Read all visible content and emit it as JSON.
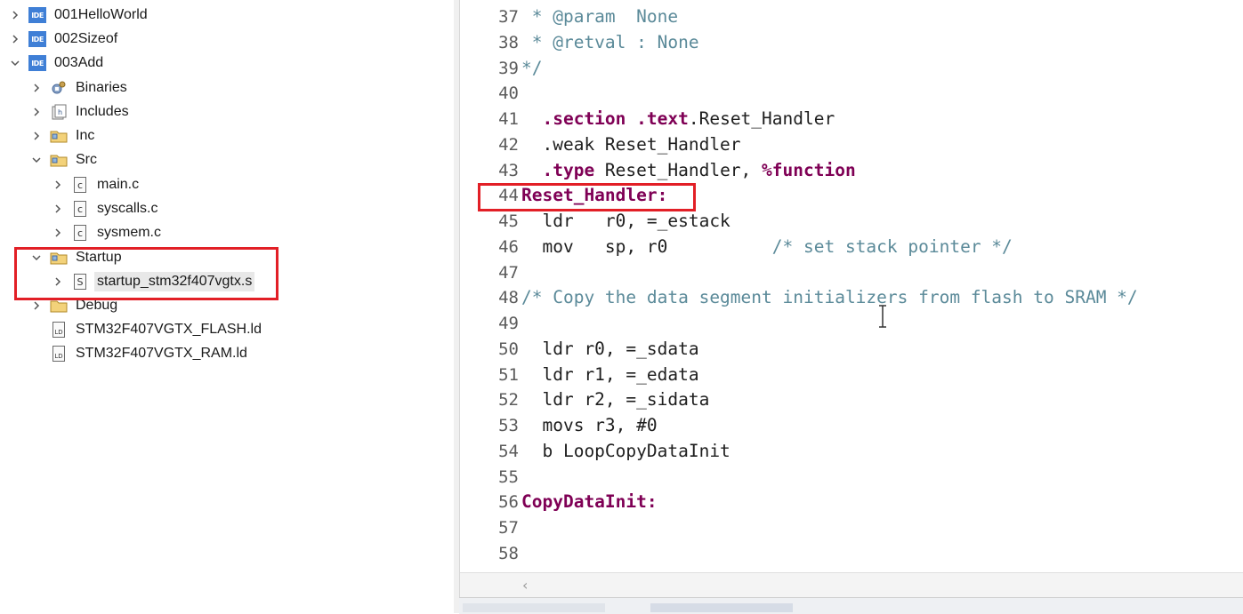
{
  "tree": {
    "projects": [
      {
        "label": "001HelloWorld",
        "expanded": false
      },
      {
        "label": "002Sizeof",
        "expanded": false
      },
      {
        "label": "003Add",
        "expanded": true
      }
    ],
    "children": {
      "binaries": "Binaries",
      "includes": "Includes",
      "inc": "Inc",
      "src": "Src",
      "src_files": [
        "main.c",
        "syscalls.c",
        "sysmem.c"
      ],
      "startup": "Startup",
      "startup_file": "startup_stm32f407vgtx.s",
      "debug": "Debug",
      "ld_files": [
        "STM32F407VGTX_FLASH.ld",
        "STM32F407VGTX_RAM.ld"
      ]
    },
    "icons": {
      "ide": "IDE",
      "c_file": "c",
      "s_file": "S",
      "ld_file": "LD"
    }
  },
  "editor": {
    "lines": [
      {
        "n": "37",
        "parts": [
          {
            "t": " * @param  None",
            "c": "cm"
          }
        ]
      },
      {
        "n": "38",
        "parts": [
          {
            "t": " * @retval : None",
            "c": "cm"
          }
        ]
      },
      {
        "n": "39",
        "parts": [
          {
            "t": "*/",
            "c": "cm"
          }
        ]
      },
      {
        "n": "40",
        "parts": []
      },
      {
        "n": "41",
        "parts": [
          {
            "t": "  ",
            "c": ""
          },
          {
            "t": ".section .text",
            "c": "kw"
          },
          {
            "t": ".Reset_Handler",
            "c": ""
          }
        ]
      },
      {
        "n": "42",
        "parts": [
          {
            "t": "  .weak Reset_Handler",
            "c": ""
          }
        ]
      },
      {
        "n": "43",
        "parts": [
          {
            "t": "  ",
            "c": ""
          },
          {
            "t": ".type",
            "c": "kw"
          },
          {
            "t": " Reset_Handler, ",
            "c": ""
          },
          {
            "t": "%function",
            "c": "kw"
          }
        ]
      },
      {
        "n": "44",
        "parts": [
          {
            "t": "Reset_Handler:",
            "c": "lab"
          }
        ]
      },
      {
        "n": "45",
        "parts": [
          {
            "t": "  ldr   r0, =_estack",
            "c": ""
          }
        ]
      },
      {
        "n": "46",
        "parts": [
          {
            "t": "  mov   sp, r0          ",
            "c": ""
          },
          {
            "t": "/* set stack pointer */",
            "c": "cm"
          }
        ]
      },
      {
        "n": "47",
        "parts": []
      },
      {
        "n": "48",
        "parts": [
          {
            "t": "/* Copy the data segment initializers from flash to SRAM */",
            "c": "cm"
          }
        ]
      },
      {
        "n": "49",
        "parts": []
      },
      {
        "n": "50",
        "parts": [
          {
            "t": "  ldr r0, =_sdata",
            "c": ""
          }
        ]
      },
      {
        "n": "51",
        "parts": [
          {
            "t": "  ldr r1, =_edata",
            "c": ""
          }
        ]
      },
      {
        "n": "52",
        "parts": [
          {
            "t": "  ldr r2, =_sidata",
            "c": ""
          }
        ]
      },
      {
        "n": "53",
        "parts": [
          {
            "t": "  movs r3, #0",
            "c": ""
          }
        ]
      },
      {
        "n": "54",
        "parts": [
          {
            "t": "  b LoopCopyDataInit",
            "c": ""
          }
        ]
      },
      {
        "n": "55",
        "parts": []
      },
      {
        "n": "56",
        "parts": [
          {
            "t": "CopyDataInit:",
            "c": "lab"
          }
        ]
      },
      {
        "n": "57",
        "parts": []
      },
      {
        "n": "58",
        "parts": []
      }
    ],
    "scroll_left_glyph": "‹"
  },
  "colors": {
    "highlight_box": "#e21f26",
    "keyword": "#7f0055",
    "comment": "#5b8a99",
    "ide_icon": "#3f7fd6"
  }
}
